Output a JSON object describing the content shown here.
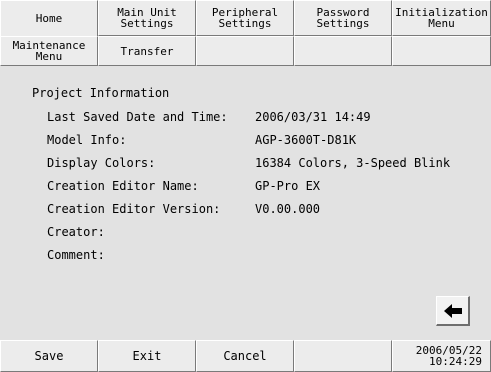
{
  "tabs_row1": [
    {
      "label": "Home"
    },
    {
      "label": "Main Unit\nSettings"
    },
    {
      "label": "Peripheral\nSettings"
    },
    {
      "label": "Password\nSettings"
    },
    {
      "label": "Initialization\nMenu"
    }
  ],
  "tabs_row2": [
    {
      "label": "Maintenance\nMenu"
    },
    {
      "label": "Transfer"
    },
    {
      "label": ""
    },
    {
      "label": ""
    },
    {
      "label": ""
    }
  ],
  "project_info": {
    "title": "Project Information",
    "rows": [
      {
        "label": "Last Saved Date and Time:",
        "value": "2006/03/31 14:49"
      },
      {
        "label": "Model Info:",
        "value": "AGP-3600T-D81K"
      },
      {
        "label": "Display Colors:",
        "value": "16384 Colors, 3-Speed Blink"
      },
      {
        "label": "Creation Editor Name:",
        "value": "GP-Pro EX"
      },
      {
        "label": "Creation Editor Version:",
        "value": "V0.00.000"
      },
      {
        "label": "Creator:",
        "value": ""
      },
      {
        "label": "Comment:",
        "value": ""
      }
    ]
  },
  "back_button": {
    "icon": "left-arrow-icon"
  },
  "footer": {
    "save_label": "Save",
    "exit_label": "Exit",
    "cancel_label": "Cancel",
    "empty_label": "",
    "date": "2006/05/22",
    "time": "10:24:29"
  }
}
